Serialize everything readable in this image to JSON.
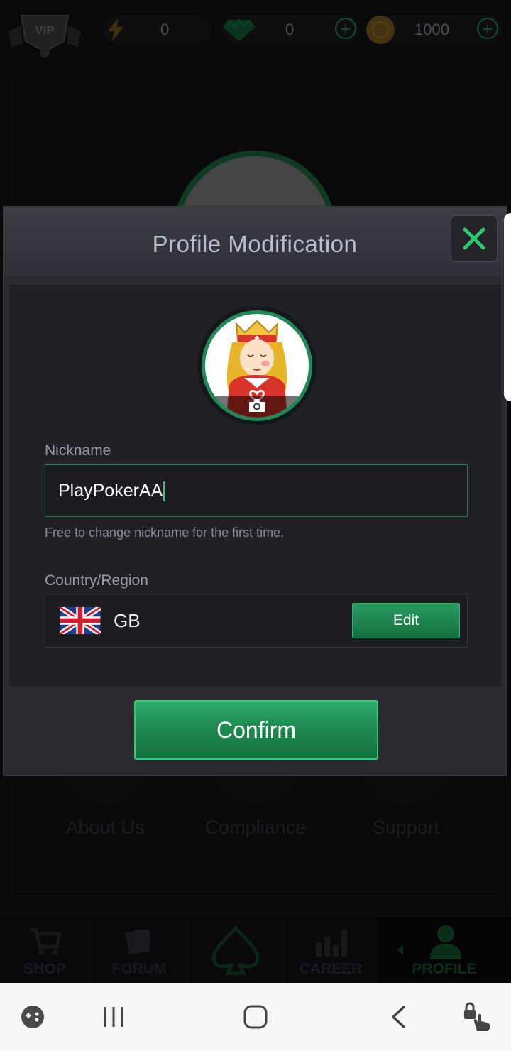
{
  "topbar": {
    "vip_label": "VIP",
    "energy": "0",
    "gems": "0",
    "coins": "1000"
  },
  "background": {
    "menu_items": [
      "About Us",
      "Compliance",
      "Support"
    ]
  },
  "bottom_nav": {
    "items": [
      {
        "label": "SHOP",
        "icon": "cart-icon"
      },
      {
        "label": "FORUM",
        "icon": "cards-icon"
      },
      {
        "label": "",
        "icon": "spade-icon"
      },
      {
        "label": "CAREER",
        "icon": "bar-chart-icon"
      },
      {
        "label": "PROFILE",
        "icon": "person-icon"
      }
    ],
    "active": "PROFILE"
  },
  "modal": {
    "title": "Profile Modification",
    "nickname_label": "Nickname",
    "nickname_value": "PlayPokerAA",
    "nickname_hint": "Free to change nickname for the first time.",
    "country_label": "Country/Region",
    "country_code": "GB",
    "edit_label": "Edit",
    "confirm_label": "Confirm"
  },
  "colors": {
    "accent_green": "#1f8a58",
    "modal_bg": "#2a2a31",
    "title_text": "#bcbcd0"
  }
}
